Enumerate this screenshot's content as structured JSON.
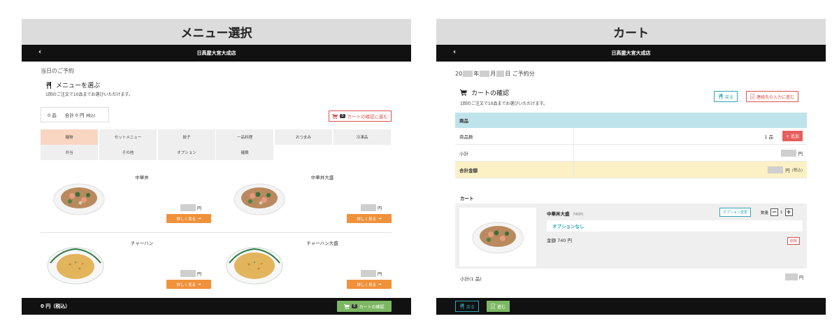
{
  "left_panel": {
    "title": "メニュー選択",
    "store_name": "日高屋大宮大成店",
    "back_glyph": "‹",
    "day_label": "当日のご予約",
    "section_title": "メニューを選ぶ",
    "note": "1回のご注文で10品までお選びいただけます。",
    "count": "0 品",
    "total": "合計 0 円",
    "tax_note": "(税込)",
    "cart_button": "カートの確認に進む",
    "cart_badge": "0",
    "categories": [
      "麺物",
      "セットメニュー",
      "餃子",
      "一品料理",
      "おつまみ",
      "冷凍品",
      "弁当",
      "その他",
      "オプション",
      "麺類"
    ],
    "products": [
      {
        "name": "中華丼",
        "price_unit": "円",
        "detail_button": "詳しく見る"
      },
      {
        "name": "中華丼大盛",
        "price_unit": "円",
        "detail_button": "詳しく見る"
      },
      {
        "name": "チャーハン",
        "price_unit": "円",
        "detail_button": "詳しく見る"
      },
      {
        "name": "チャーハン大盛",
        "price_unit": "円",
        "detail_button": "詳しく見る"
      }
    ],
    "bottom_price": "0 円（税込）",
    "bottom_button": "カートの確認",
    "bottom_badge": "0"
  },
  "right_panel": {
    "title": "カート",
    "store_name": "日高屋大宮大成店",
    "back_glyph": "‹",
    "date_parts": [
      "20",
      "年",
      "月",
      "日 ご予約分"
    ],
    "section_title": "カートの確認",
    "note": "1回のご注文で10品までお選びいただけます。",
    "back_button": "戻る",
    "next_button": "連絡先の入力に進む",
    "table": {
      "header": "商品",
      "rows": [
        {
          "label": "商品数",
          "value": "1 品",
          "action": "追加"
        },
        {
          "label": "小計",
          "unit": "円"
        },
        {
          "label": "合計金額",
          "unit": "円",
          "tax": "(税込)"
        }
      ]
    },
    "cart_label": "カート",
    "cart_item": {
      "name": "中華丼大盛",
      "unit_price": "740円",
      "option_change": "オプション変更",
      "qty_label": "数量",
      "qty_minus": "−",
      "qty_value": "1",
      "qty_plus": "+",
      "option_text": "オプションなし",
      "amount": "金額 740 円",
      "delete": "削除"
    },
    "subtotal_label": "小計(1 品)",
    "subtotal_unit": "円",
    "bottom_back": "戻る",
    "bottom_next": "進む"
  },
  "colors": {
    "orange": "#f0923b",
    "green": "#7cb863",
    "teal": "#2fa3b5",
    "red": "#d9534f",
    "light_blue": "#bfe3ea",
    "light_yellow": "#fcf0c5",
    "active_tab": "#f9d6c2"
  },
  "icons": [
    "fork-knife-icon",
    "cart-icon",
    "arrow-right-icon",
    "plus-icon",
    "document-icon",
    "chevron-left-icon"
  ]
}
